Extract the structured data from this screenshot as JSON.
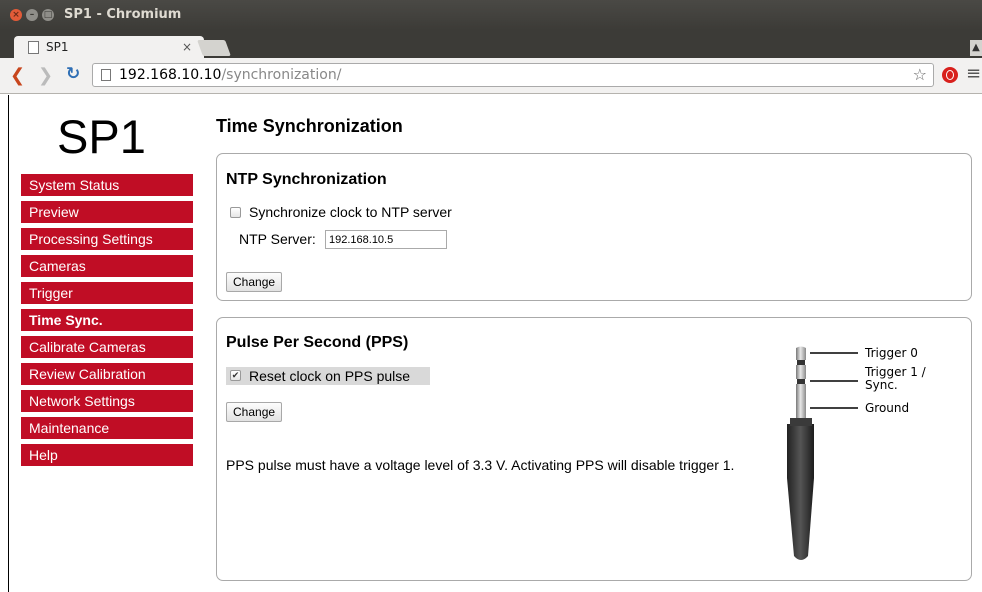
{
  "window": {
    "title": "SP1 - Chromium"
  },
  "tab": {
    "title": "SP1",
    "close": "×"
  },
  "address": {
    "host": "192.168.10.10",
    "path": "/synchronization/"
  },
  "sidebar": {
    "logo": "SP1",
    "items": [
      {
        "label": "System Status"
      },
      {
        "label": "Preview"
      },
      {
        "label": "Processing Settings"
      },
      {
        "label": "Cameras"
      },
      {
        "label": "Trigger"
      },
      {
        "label": "Time Sync."
      },
      {
        "label": "Calibrate Cameras"
      },
      {
        "label": "Review Calibration"
      },
      {
        "label": "Network Settings"
      },
      {
        "label": "Maintenance"
      },
      {
        "label": "Help"
      }
    ],
    "active_index": 5
  },
  "main": {
    "title": "Time Synchronization",
    "ntp": {
      "title": "NTP Synchronization",
      "checkbox_label": "Synchronize clock to NTP server",
      "checked": false,
      "server_label": "NTP Server:",
      "server_value": "192.168.10.5",
      "button": "Change"
    },
    "pps": {
      "title": "Pulse Per Second (PPS)",
      "checkbox_label": "Reset clock on PPS pulse",
      "checked": true,
      "check_mark": "✔",
      "button": "Change",
      "note": "PPS pulse must have a voltage level of 3.3 V. Activating PPS will disable trigger 1.",
      "jack_labels": {
        "trigger0": "Trigger 0",
        "trigger1_line1": "Trigger 1 /",
        "trigger1_line2": "Sync.",
        "ground": "Ground"
      }
    }
  },
  "colors": {
    "nav_bg": "#c00d25",
    "nav_text": "#ffffff",
    "panel_border": "#aaaaaa"
  },
  "icons": {
    "back": "back-arrow-icon",
    "forward": "forward-arrow-icon",
    "reload": "reload-icon",
    "star": "bookmark-star-icon",
    "menu": "hamburger-menu-icon"
  }
}
